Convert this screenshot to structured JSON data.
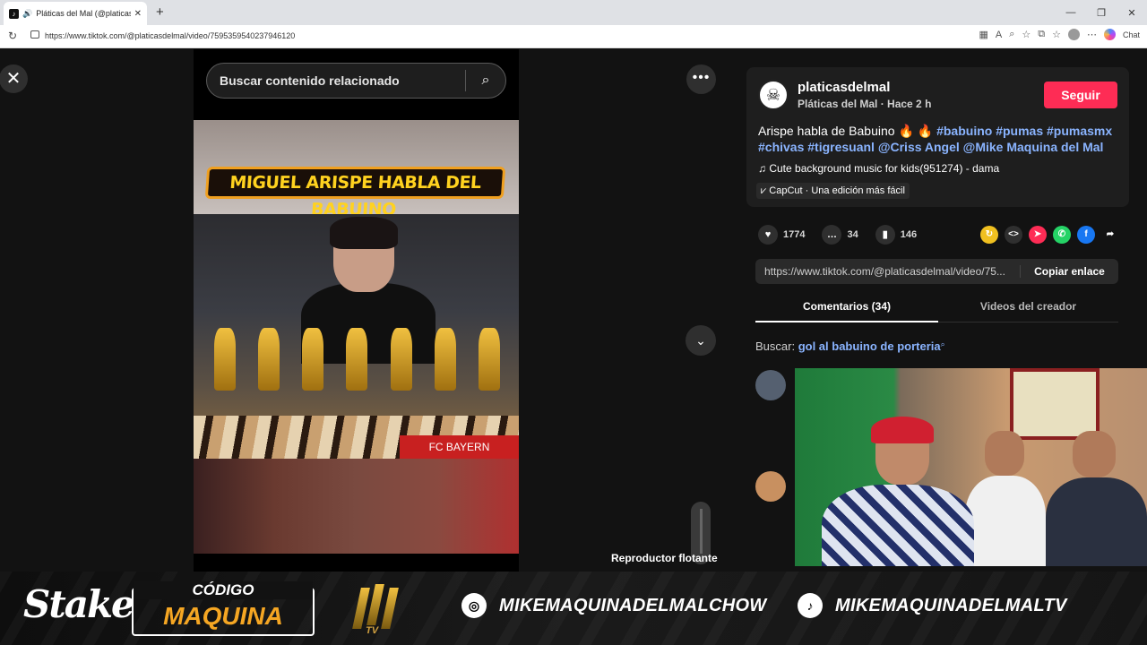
{
  "browser": {
    "tab_title": "Pláticas del Mal (@platicasdel",
    "url": "https://www.tiktok.com/@platicasdelmal/video/7595359540237946120",
    "chat_label": "Chat"
  },
  "player": {
    "search_placeholder": "Buscar contenido relacionado",
    "banner_text": "MIGUEL ARISPE HABLA DEL BABUINO",
    "jersey_text": "FC BAYERN",
    "floating_player_label": "Reproductor flotante"
  },
  "post": {
    "username": "platicasdelmal",
    "display_name_time": "Pláticas del Mal · Hace 2 h",
    "follow_label": "Seguir",
    "description_text": "Arispe habla de Babuino 🔥 🔥 ",
    "hashtags": "#babuino #pumas #pumasmx #chivas #tigresuanl @Criss Angel @Mike Maquina del Mal",
    "music": "Cute background music for kids(951274) - dama",
    "capcut": "CapCut · Una edición más fácil",
    "likes": "1774",
    "comments": "34",
    "saves": "146",
    "link": "https://www.tiktok.com/@platicasdelmal/video/75...",
    "copy_link_label": "Copiar enlace",
    "tab_comments": "Comentarios (34)",
    "tab_creator_videos": "Videos del creador",
    "search_prefix": "Buscar:",
    "search_suggestion": "gol al babuino de porteria"
  },
  "overlay": {
    "sponsor": "Stake",
    "code_label": "CÓDIGO",
    "code_value": "MAQUINA",
    "mtv_label": "TV",
    "instagram": "MIKEMAQUINADELMALCHOW",
    "tiktok": "MIKEMAQUINADELMALTV"
  },
  "colors": {
    "follow": "#fe2c55",
    "accent_link": "#8ab4ff",
    "code": "#f5a623"
  }
}
